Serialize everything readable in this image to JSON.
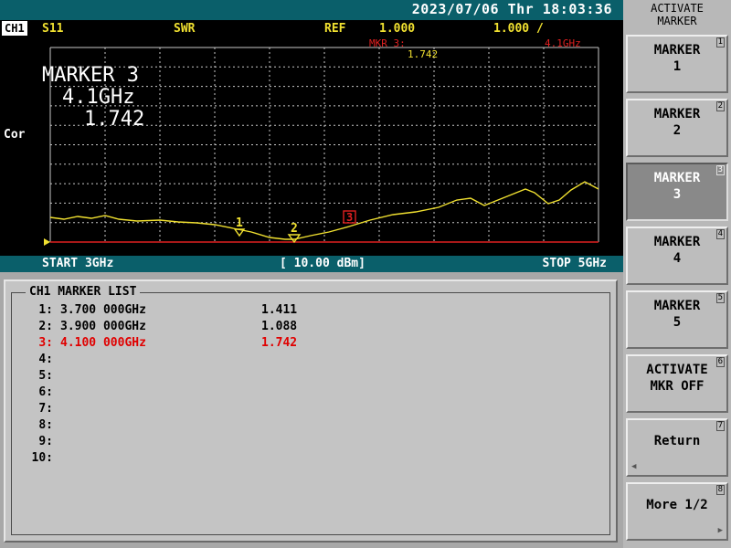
{
  "header": {
    "datetime": "2023/07/06 Thr 18:03:36"
  },
  "trace": {
    "channel_tag": "CH1",
    "parameter": "S11",
    "format": "SWR",
    "ref_label": "REF",
    "ref_value": "1.000",
    "scale_value": "1.000 /",
    "correction": "Cor",
    "marker_readout": {
      "label": "MKR 3:",
      "freq": "4.1GHz",
      "value": "1.742"
    },
    "big_readout": {
      "title": "MARKER 3",
      "freq": "4.1GHz",
      "value": "1.742"
    },
    "start": "START 3GHz",
    "power": "[ 10.00 dBm]",
    "stop": "STOP 5GHz",
    "markers_on_trace": [
      "1",
      "2",
      "3"
    ],
    "colors": {
      "trace": "#f0e030",
      "grid": "#c8c8c8",
      "ref_line": "#e02020",
      "active_marker": "#e02020"
    }
  },
  "marker_list": {
    "title": "CH1 MARKER LIST",
    "rows": [
      {
        "idx": "1:",
        "freq": "3.700 000GHz",
        "value": "1.411"
      },
      {
        "idx": "2:",
        "freq": "3.900 000GHz",
        "value": "1.088"
      },
      {
        "idx": "3:",
        "freq": "4.100 000GHz",
        "value": "1.742"
      },
      {
        "idx": "4:",
        "freq": "",
        "value": ""
      },
      {
        "idx": "5:",
        "freq": "",
        "value": ""
      },
      {
        "idx": "6:",
        "freq": "",
        "value": ""
      },
      {
        "idx": "7:",
        "freq": "",
        "value": ""
      },
      {
        "idx": "8:",
        "freq": "",
        "value": ""
      },
      {
        "idx": "9:",
        "freq": "",
        "value": ""
      },
      {
        "idx": "10:",
        "freq": "",
        "value": ""
      }
    ]
  },
  "softkeys": {
    "menu_title_line1": "ACTIVATE",
    "menu_title_line2": "MARKER",
    "keys": [
      {
        "num": "1",
        "line1": "MARKER",
        "line2": "1"
      },
      {
        "num": "2",
        "line1": "MARKER",
        "line2": "2"
      },
      {
        "num": "3",
        "line1": "MARKER",
        "line2": "3"
      },
      {
        "num": "4",
        "line1": "MARKER",
        "line2": "4"
      },
      {
        "num": "5",
        "line1": "MARKER",
        "line2": "5"
      },
      {
        "num": "6",
        "line1": "ACTIVATE",
        "line2": "MKR OFF"
      },
      {
        "num": "7",
        "line1": "Return",
        "line2": ""
      },
      {
        "num": "8",
        "line1": "More 1/2",
        "line2": ""
      }
    ]
  }
}
